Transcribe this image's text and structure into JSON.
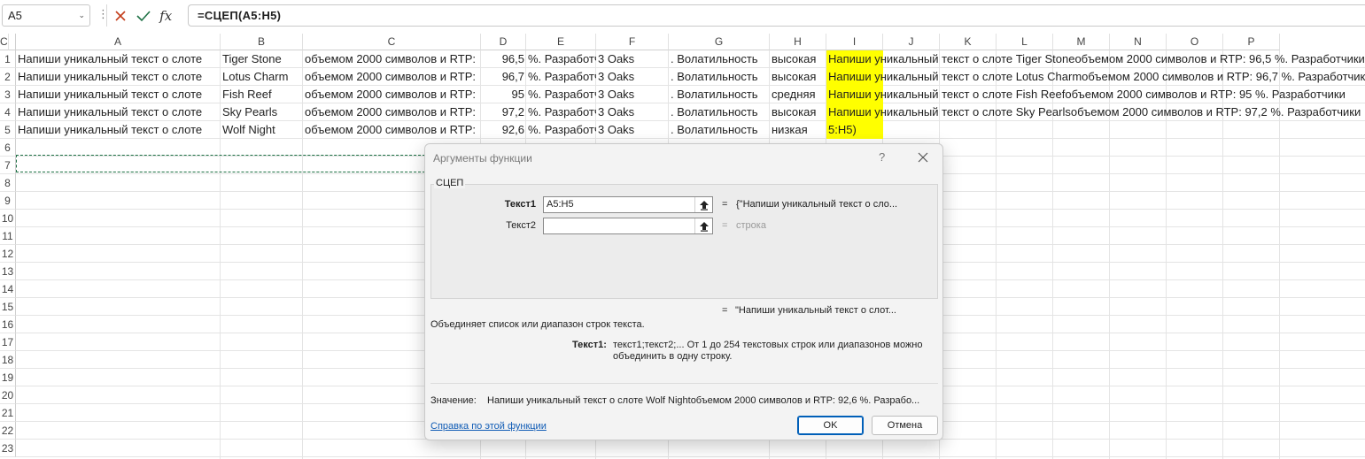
{
  "formula_bar": {
    "name_box": "A5",
    "name_box_caret": "⌄",
    "dots": "⋮",
    "fx_label": "fx",
    "formula": "=СЦЕП(A5:H5)",
    "icons": {
      "cancel": "close-icon",
      "enter": "checkmark-icon",
      "function": "fx-icon",
      "name_dropdown": "chevron-down-icon"
    },
    "colors": {
      "cancel": "#c43e1c",
      "enter": "#1e7145"
    }
  },
  "sheet": {
    "columns": [
      "A",
      "B",
      "C",
      "D",
      "E",
      "F",
      "G",
      "H",
      "I",
      "J",
      "K",
      "L",
      "M",
      "N",
      "O",
      "P",
      "C"
    ],
    "rows": [
      "1",
      "2",
      "3",
      "4",
      "5",
      "6",
      "7",
      "8",
      "9",
      "10",
      "11",
      "12",
      "13",
      "14",
      "15",
      "16",
      "17",
      "18",
      "19",
      "20",
      "21",
      "22",
      "23"
    ],
    "data_rows": [
      {
        "a": "Напиши уникальный текст о слоте",
        "b": "Tiger Stone",
        "c": "объемом 2000 символов и RTP:",
        "d": "96,5",
        "e": "%. Разработчики слота",
        "f": "3 Oaks",
        "g": ". Волатильность",
        "h": "высокая",
        "i": "Напиши уникальный текст о слоте Tiger Stoneобъемом 2000 символов и RTP: 96,5 %. Разработчики"
      },
      {
        "a": "Напиши уникальный текст о слоте",
        "b": "Lotus Charm",
        "c": "объемом 2000 символов и RTP:",
        "d": "96,7",
        "e": "%. Разработчики слота",
        "f": "3 Oaks",
        "g": ". Волатильность",
        "h": "высокая",
        "i": "Напиши уникальный текст о слоте Lotus Charmобъемом 2000 символов и RTP: 96,7 %. Разработчики"
      },
      {
        "a": "Напиши уникальный текст о слоте",
        "b": "Fish Reef",
        "c": "объемом 2000 символов и RTP:",
        "d": "95",
        "e": "%. Разработчики слота",
        "f": "3 Oaks",
        "g": ". Волатильность",
        "h": "средняя",
        "i": "Напиши уникальный текст о слоте Fish Reefобъемом 2000 символов и RTP: 95 %. Разработчики"
      },
      {
        "a": "Напиши уникальный текст о слоте",
        "b": "Sky Pearls",
        "c": "объемом 2000 символов и RTP:",
        "d": "97,2",
        "e": "%. Разработчики слота",
        "f": "3 Oaks",
        "g": ". Волатильность",
        "h": "высокая",
        "i": "Напиши уникальный текст о слоте Sky Pearlsобъемом 2000 символов и RTP: 97,2 %. Разработчики"
      },
      {
        "a": "Напиши уникальный текст о слоте",
        "b": "Wolf Night",
        "c": "объемом 2000 символов и RTP:",
        "d": "92,6",
        "e": "%. Разработчики слота",
        "f": "3 Oaks",
        "g": ". Волатильность",
        "h": "низкая",
        "i": "5:H5)"
      }
    ],
    "colors": {
      "highlight": "#ffff00",
      "marquee": "#1e7145"
    }
  },
  "dialog": {
    "title": "Аргументы функции",
    "help": "?",
    "function_name": "СЦЕП",
    "args": [
      {
        "label": "Текст1",
        "value": "A5:H5",
        "result": "{\"Напиши уникальный текст о сло...",
        "result_gray": false
      },
      {
        "label": "Текст2",
        "value": "",
        "result": "строка",
        "result_gray": true
      }
    ],
    "eq": "=",
    "formula_result": "\"Напиши уникальный текст о слот...",
    "description": "Объединяет список или диапазон строк текста.",
    "arg_title": "Текст1:",
    "arg_description": "текст1;текст2;... От 1 до 254 текстовых строк или диапазонов можно объединить в одну строку.",
    "value_label": "Значение:",
    "value": "Напиши уникальный текст о слоте Wolf Nightобъемом 2000 символов и RTP: 92,6 %. Разрабо...",
    "help_link": "Справка по этой функции",
    "ok": "OK",
    "cancel": "Отмена",
    "icons": {
      "close": "close-icon",
      "collapse": "collapse-arrow-icon"
    }
  }
}
